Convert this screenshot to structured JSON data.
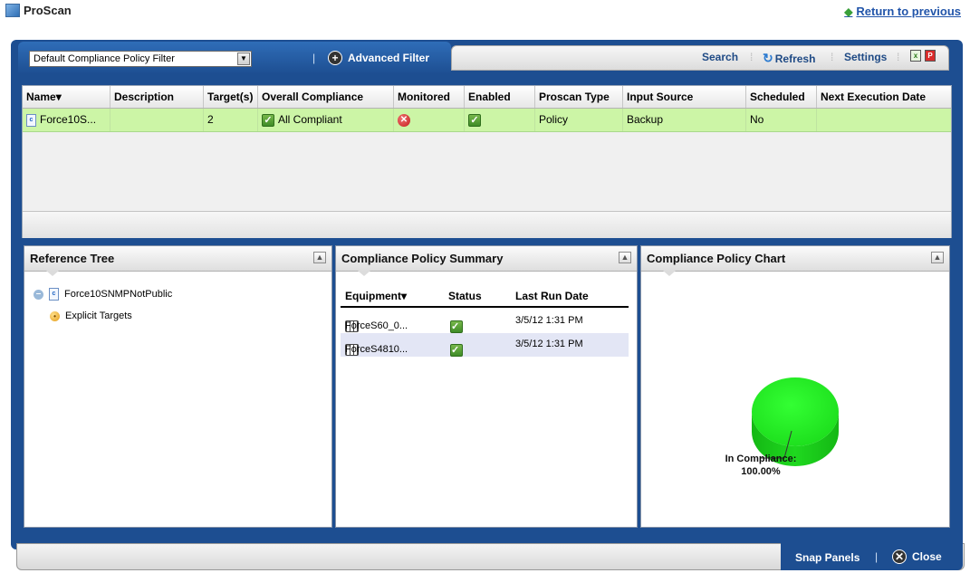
{
  "app": {
    "title": "ProScan",
    "return_link": "Return to previous"
  },
  "toolbar": {
    "filter_value": "Default Compliance Policy Filter",
    "advanced_filter": "Advanced Filter",
    "search": "Search",
    "refresh": "Refresh",
    "settings": "Settings"
  },
  "grid": {
    "columns": [
      "Name",
      "Description",
      "Target(s)",
      "Overall Compliance",
      "Monitored",
      "Enabled",
      "Proscan Type",
      "Input Source",
      "Scheduled",
      "Next Execution Date"
    ],
    "row": {
      "name": "Force10S...",
      "description": "",
      "targets": "2",
      "overall_compliance": "All Compliant",
      "monitored_icon": "red-x-icon",
      "enabled_icon": "green-check-icon",
      "proscan_type": "Policy",
      "input_source": "Backup",
      "scheduled": "No",
      "next_execution_date": ""
    },
    "row_color": "#ccf5a6"
  },
  "panels": {
    "reference_tree": {
      "title": "Reference Tree",
      "root": "Force10SNMPNotPublic",
      "child": "Explicit Targets"
    },
    "summary": {
      "title": "Compliance Policy Summary",
      "headers": {
        "equipment": "Equipment",
        "status": "Status",
        "last_run": "Last Run Date"
      },
      "rows": [
        {
          "equipment": "ForceS60_0...",
          "last_run": "3/5/12 1:31 PM"
        },
        {
          "equipment": "ForceS4810...",
          "last_run": "3/5/12 1:31 PM"
        }
      ]
    },
    "chart": {
      "title": "Compliance Policy Chart",
      "label": "In Compliance:",
      "value": "100.00%"
    }
  },
  "chart_data": {
    "type": "pie",
    "categories": [
      "In Compliance"
    ],
    "values": [
      100.0
    ],
    "labels": [
      "In Compliance: 100.00%"
    ],
    "color": "#22ee22"
  },
  "bottom": {
    "snap_panels": "Snap Panels",
    "close": "Close"
  },
  "colors": {
    "frame": "#1d4e91",
    "link": "#2255aa",
    "accent_green": "#3aa03a"
  }
}
